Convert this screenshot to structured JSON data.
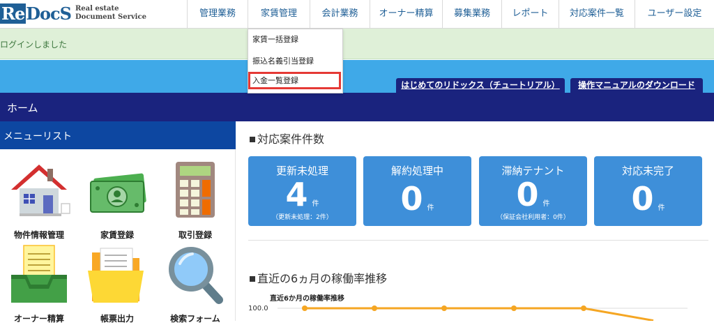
{
  "header": {
    "logo_text": "ReDocS",
    "logo_re": "Re",
    "logo_docs": "DocS",
    "logo_sub1": "Real estate",
    "logo_sub2": "Document Service",
    "nav": [
      {
        "label": "管理業務"
      },
      {
        "label": "家賃管理"
      },
      {
        "label": "会計業務"
      },
      {
        "label": "オーナー精算"
      },
      {
        "label": "募集業務"
      },
      {
        "label": "レポート"
      },
      {
        "label": "対応案件一覧"
      },
      {
        "label": "ユーザー設定"
      }
    ]
  },
  "dropdown": {
    "items": [
      {
        "label": "家賃一括登録"
      },
      {
        "label": "振込名義引当登録"
      },
      {
        "label": "入金一覧登録"
      }
    ]
  },
  "login_message": "ログインしました",
  "banner": {
    "tutorial_label": "はじめてのリドックス（チュートリアル）",
    "manual_label": "操作マニュアルのダウンロード"
  },
  "home_label": "ホーム",
  "menu": {
    "title": "メニューリスト",
    "tiles": [
      {
        "label": "物件情報管理",
        "icon": "house-icon"
      },
      {
        "label": "家賃登録",
        "icon": "money-icon"
      },
      {
        "label": "取引登録",
        "icon": "calculator-icon"
      },
      {
        "label": "オーナー精算",
        "icon": "inbox-tray-icon"
      },
      {
        "label": "帳票出力",
        "icon": "folder-icon"
      },
      {
        "label": "検索フォーム",
        "icon": "magnifier-icon"
      }
    ]
  },
  "cases": {
    "title": "対応案件件数",
    "cards": [
      {
        "title": "更新未処理",
        "count": "4",
        "unit": "件",
        "note": "（更新未処理：2件）"
      },
      {
        "title": "解約処理中",
        "count": "0",
        "unit": "件",
        "note": ""
      },
      {
        "title": "滞納テナント",
        "count": "0",
        "unit": "件",
        "note": "（保証会社利用者：0件）"
      },
      {
        "title": "対応未完了",
        "count": "0",
        "unit": "件",
        "note": ""
      }
    ]
  },
  "occupancy": {
    "title": "直近の6ヵ月の稼働率推移",
    "chart_title": "直近6か月の稼働率推移",
    "y_tick_top": "100.0",
    "values": [
      100,
      100,
      100,
      100,
      100,
      92
    ],
    "ylim_top": 100,
    "line_color": "#f5a623"
  },
  "colors": {
    "nav_text": "#1f5f96",
    "banner": "#3fa9e8",
    "dark_navy": "#1a237e",
    "menu_head": "#0d47a1",
    "card": "#3e8fd9",
    "highlight": "#e53935"
  }
}
